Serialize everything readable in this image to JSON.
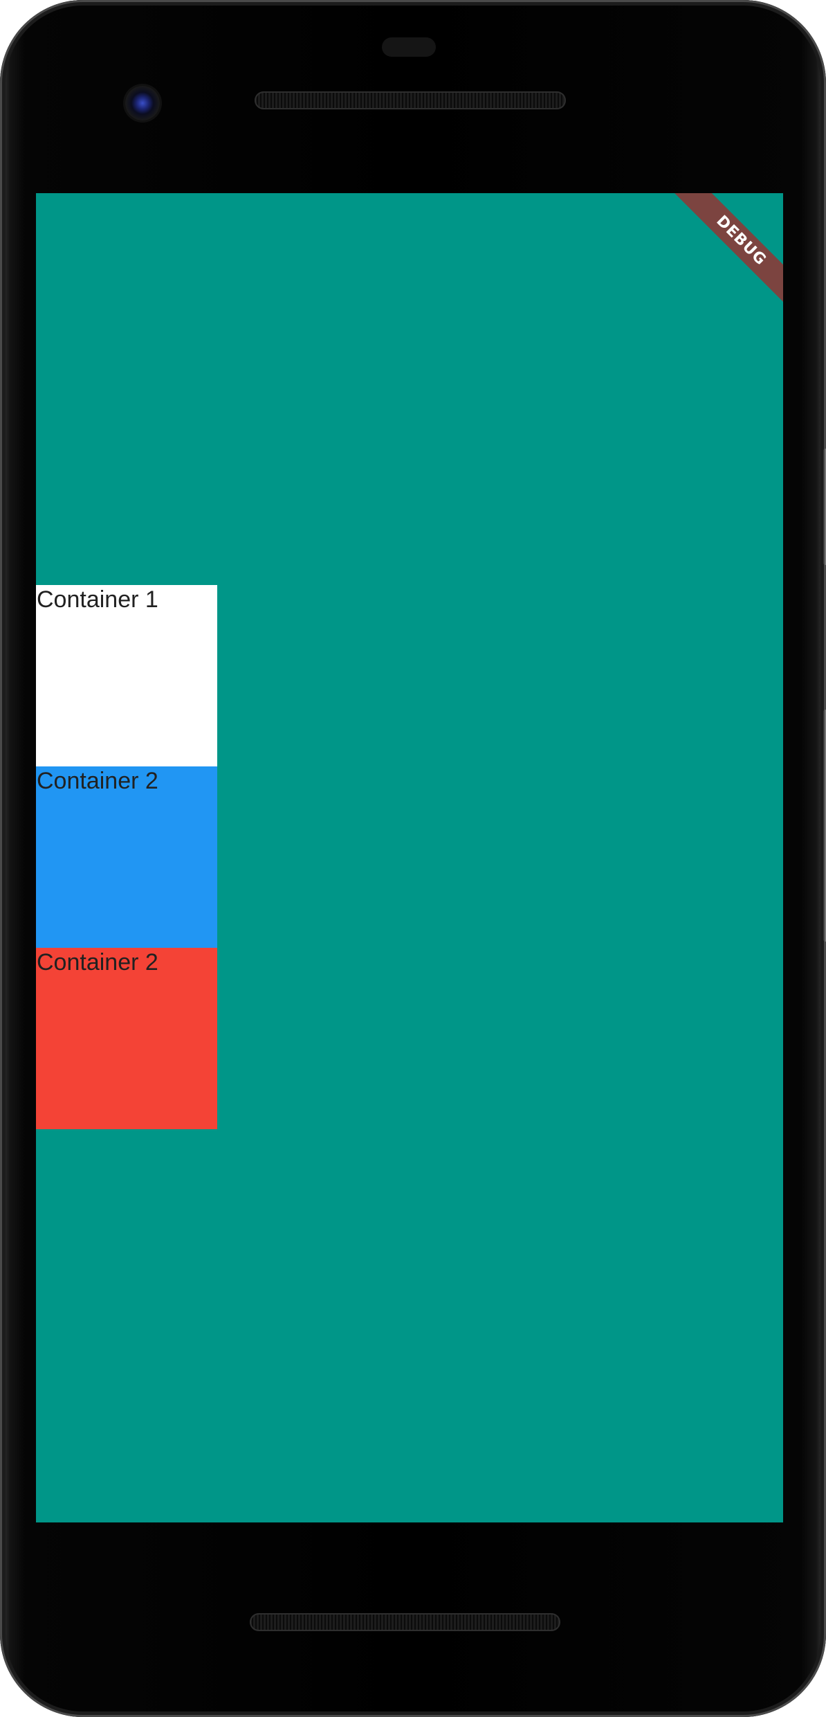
{
  "screen": {
    "background_color": "#009688",
    "debug_banner": "DEBUG",
    "containers": [
      {
        "label": "Container 1",
        "color": "#ffffff"
      },
      {
        "label": "Container 2",
        "color": "#2196f3"
      },
      {
        "label": "Container 2",
        "color": "#f44336"
      }
    ]
  },
  "device": {
    "icons": [
      "front-camera-icon",
      "earpiece-speaker-icon",
      "bottom-speaker-icon"
    ]
  }
}
